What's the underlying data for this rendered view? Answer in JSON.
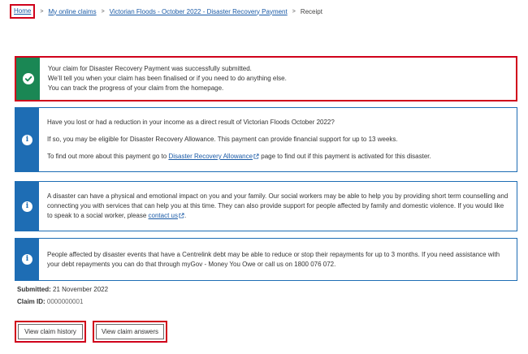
{
  "breadcrumb": {
    "home": "Home",
    "online_claims": "My online claims",
    "claim_event": "Victorian Floods - October 2022 - Disaster Recovery Payment",
    "current": "Receipt",
    "separator": ">"
  },
  "success_alert": {
    "line1": "Your claim for Disaster Recovery Payment was successfully submitted.",
    "line2": "We’ll tell you when your claim has been finalised or if you need to do anything else.",
    "line3": "You can track the progress of your claim from the homepage."
  },
  "info_income": {
    "question": "Have you lost or had a reduction in your income as a direct result of Victorian Floods October 2022?",
    "eligibility": "If so, you may be eligible for Disaster Recovery Allowance. This payment can provide financial support for up to 13 weeks.",
    "more_prefix": "To find out more about this payment go to",
    "link": "Disaster Recovery Allowance",
    "more_suffix": "page to find out if this payment is activated for this disaster."
  },
  "info_social_worker": {
    "text": "A disaster can have a physical and emotional impact on you and your family. Our social workers may be able to help you by providing short term counselling and connecting you with services that can help you at this time. They can also provide support for people affected by family and domestic violence. If you would like to speak to a social worker, please",
    "link": "contact us",
    "suffix": "."
  },
  "info_debt": {
    "text": "People affected by disaster events that have a Centrelink debt may be able to reduce or stop their repayments for up to 3 months. If you need assistance with your debt repayments you can do that through myGov - Money You Owe or call us on 1800 076 072."
  },
  "meta": {
    "submitted_label": "Submitted:",
    "submitted_value": "21 November 2022",
    "claim_id_label": "Claim ID:",
    "claim_id_value": "0000000001"
  },
  "buttons": {
    "history": "View claim history",
    "answers": "View claim answers"
  },
  "colors": {
    "success": "#1a8754",
    "info": "#1e6db4",
    "link": "#1a5aa6",
    "highlight": "#d0021b"
  },
  "icons": {
    "success": "check-circle-icon",
    "info": "info-circle-icon",
    "external": "external-link-icon"
  }
}
